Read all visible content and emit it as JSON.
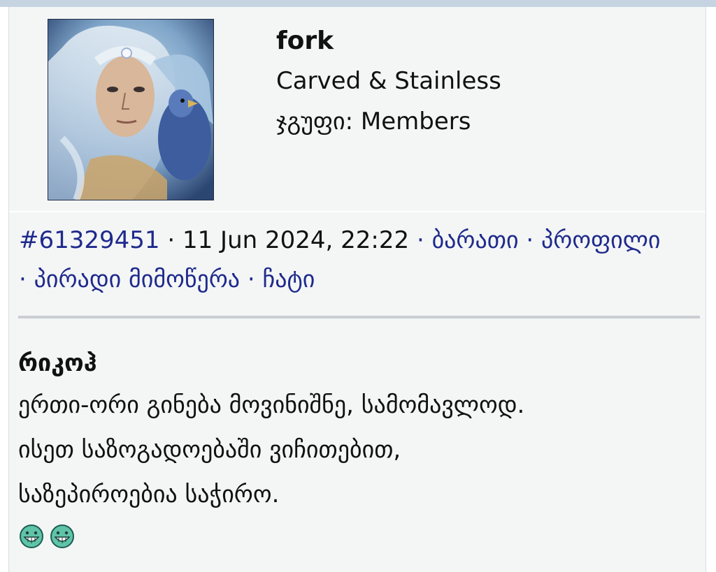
{
  "post": {
    "author": {
      "name": "fork",
      "title": "Carved & Stainless",
      "group_label": "ჯგუფი:",
      "group_value": "Members"
    },
    "meta": {
      "post_id": "#61329451",
      "separator": "·",
      "datetime": "11 Jun 2024, 22:22",
      "links": [
        "ბარათი",
        "პროფილი",
        "პირადი მიმოწერა",
        "ჩატი"
      ]
    },
    "body": {
      "title": "რიკოჰ",
      "lines": [
        "ერთი-ორი გინება მოვინიშნე, სამომავლოდ.",
        "ისეთ საზოგადოებაში ვიჩითებით,",
        "საზეპიროებია საჭირო."
      ],
      "smileys": [
        "grin-smiley-icon",
        "grin-smiley-icon"
      ]
    }
  },
  "colors": {
    "link": "#1f2a8c",
    "background": "#f4f6f6",
    "topbar": "#c6d4e2"
  }
}
